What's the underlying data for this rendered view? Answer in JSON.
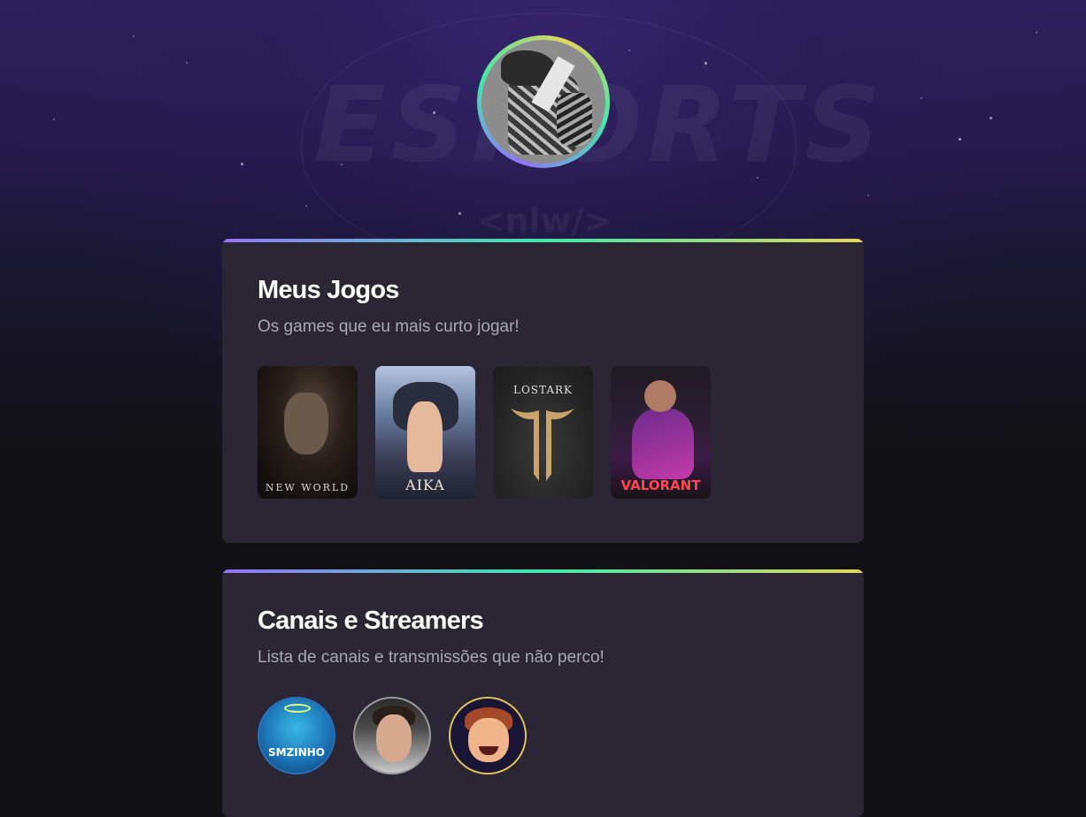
{
  "watermark": {
    "word": "ESPORTS",
    "tag": "<nlw/>"
  },
  "profile": {
    "avatar_icon": "sketch-portrait-avatar"
  },
  "games_section": {
    "title": "Meus Jogos",
    "subtitle": "Os games que eu mais curto jogar!",
    "games": [
      {
        "label": "NEW WORLD"
      },
      {
        "label": "AIKA"
      },
      {
        "label": "LOSTARK"
      },
      {
        "label": "VALORANT"
      }
    ]
  },
  "streamers_section": {
    "title": "Canais e Streamers",
    "subtitle": "Lista de canais e transmissões que não perco!",
    "streamers": [
      {
        "label": "SMZINHO"
      }
    ]
  },
  "colors": {
    "card_bg": "#2a2634",
    "page_bg": "#121214",
    "gradient_start": "#9572fc",
    "gradient_mid": "#43e7ad",
    "gradient_end": "#e1d55d",
    "subtitle": "#a8a8b3"
  }
}
